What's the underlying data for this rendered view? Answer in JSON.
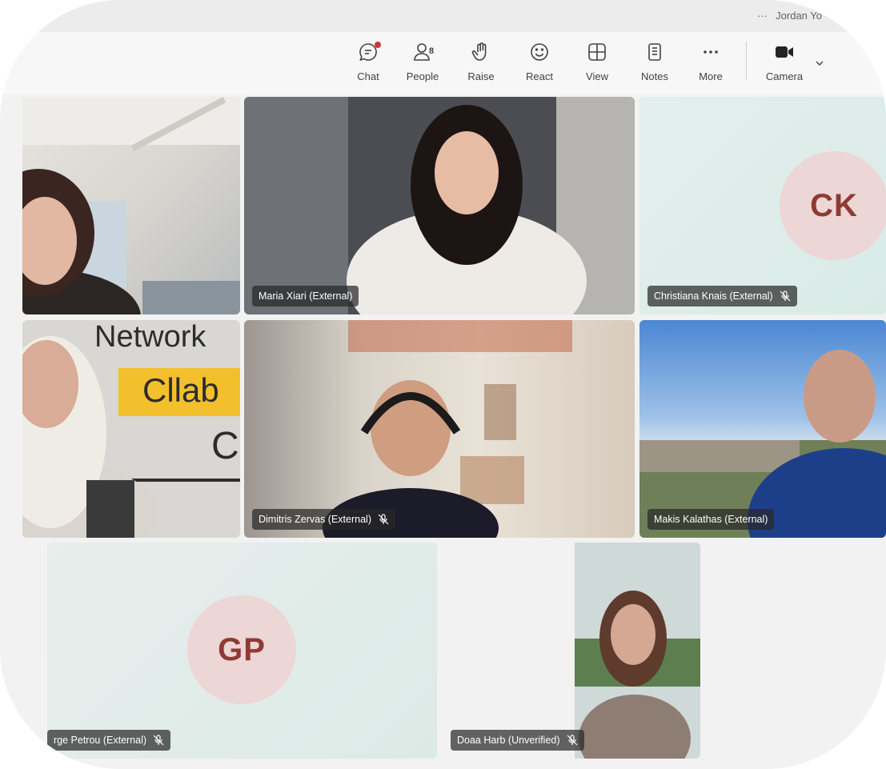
{
  "titlebar": {
    "more": "···",
    "user": "Jordan Yo"
  },
  "toolbar": {
    "chat": "Chat",
    "people": "People",
    "people_count": "8",
    "raise": "Raise",
    "react": "React",
    "view": "View",
    "notes": "Notes",
    "more": "More",
    "camera": "Camera"
  },
  "participants": [
    {
      "name": "",
      "muted": false
    },
    {
      "name": "Maria Xiari (External)",
      "muted": false
    },
    {
      "name": "Christiana Knais (External)",
      "initials": "CK",
      "muted": true
    },
    {
      "name": "",
      "muted": false
    },
    {
      "name": "Dimitris Zervas (External)",
      "muted": true
    },
    {
      "name": "Makis Kalathas (External)",
      "muted": false
    },
    {
      "name": "rge Petrou (External)",
      "initials": "GP",
      "muted": true
    },
    {
      "name": "Doaa Harb (Unverified)",
      "muted": true
    }
  ],
  "colors": {
    "toolbar_bg": "#f7f7f7",
    "avatar_bg": "#ecd6d6",
    "avatar_text": "#8f3a32",
    "notification_dot": "#d13438"
  },
  "background_text": {
    "line1": "Network",
    "line2": "Cllab",
    "line3": "C"
  }
}
